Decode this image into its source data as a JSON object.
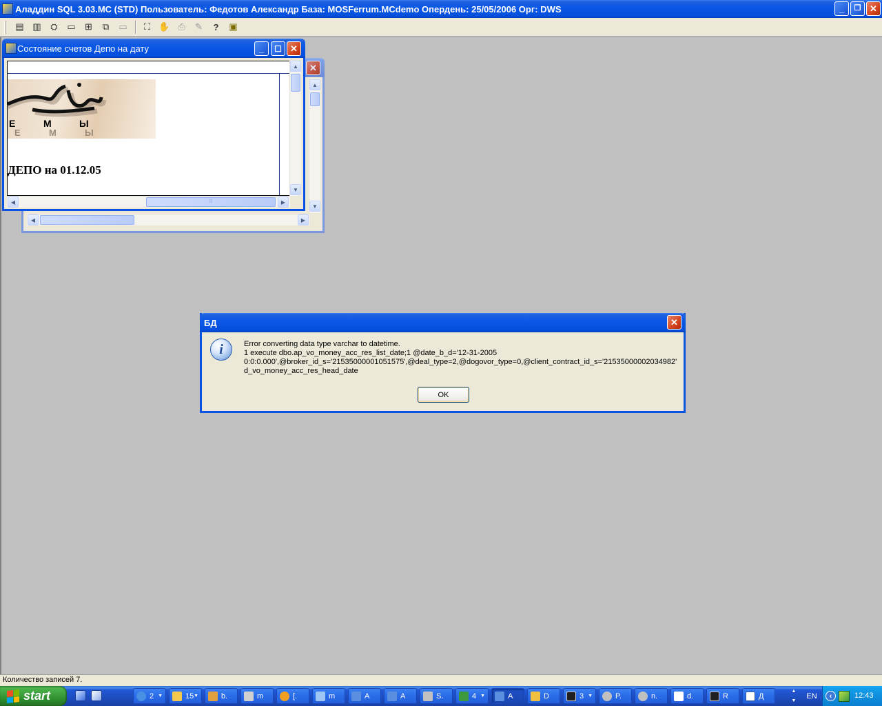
{
  "app": {
    "title": "Аладдин SQL 3.03.MC (STD)  Пользователь: Федотов Александр База: MOSFerrum.MCdemo Опердень: 25/05/2006 Орг: DWS",
    "caption_buttons": {
      "minimize": "_",
      "restore": "❐",
      "close": "✕"
    }
  },
  "toolbar": {
    "icons": [
      "list-icon",
      "database-icon",
      "tree-icon",
      "window-icon",
      "tile-icon",
      "cascade-icon",
      "window-disabled-icon",
      "find-icon",
      "stop-icon",
      "print-icon",
      "edit-disabled-icon",
      "help-icon",
      "exit-icon"
    ],
    "glyphs": [
      "▤",
      "▥",
      "⛭",
      "▭",
      "⊞",
      "⧉",
      "▭",
      "⛶",
      "✋",
      "⎙",
      "✎",
      "?",
      "▣"
    ]
  },
  "window_front": {
    "title": "Состояние счетов Депо на дату",
    "logo_letters": [
      "Е",
      "М",
      "Ы"
    ],
    "logo_shadow_letters": [
      "Е",
      "М",
      "Ы"
    ],
    "heading": "ДЕПО на 01.12.05",
    "caption_buttons": {
      "minimize": "_",
      "maximize": "☐",
      "close": "✕"
    }
  },
  "window_back": {
    "caption_buttons": {
      "close": "✕"
    }
  },
  "scroll_glyphs": {
    "up": "▲",
    "down": "▼",
    "left": "◀",
    "right": "▶",
    "grip": "⦙⦙⦙"
  },
  "dialog": {
    "title": "БД",
    "icon": "info-icon",
    "icon_glyph": "i",
    "lines": [
      "Error converting data type varchar to datetime.",
      "1 execute dbo.ap_vo_money_acc_res_list_date;1 @date_b_d='12-31-2005",
      "0:0:0.000',@broker_id_s='21535000001051575',@deal_type=2,@dogovor_type=0,@client_contract_id_s='21535000002034982'",
      "d_vo_money_acc_res_head_date"
    ],
    "ok_label": "OK",
    "close_glyph": "✕"
  },
  "statusbar": {
    "text": "Количество записей 7."
  },
  "taskbar": {
    "start_label": "start",
    "buttons": [
      {
        "label": "2",
        "group": true,
        "color": "#4a90e2"
      },
      {
        "label": "15",
        "group": true,
        "color": "#f2c94c"
      },
      {
        "label": "b.",
        "group": false,
        "color": "#e0a040"
      },
      {
        "label": "m",
        "group": false,
        "color": "#d0d0d0"
      },
      {
        "label": "[.",
        "group": false,
        "color": "#f0a020"
      },
      {
        "label": "m",
        "group": false,
        "color": "#9ec6f5"
      },
      {
        "label": "A",
        "group": false,
        "color": "#5a8fe0"
      },
      {
        "label": "A",
        "group": false,
        "color": "#5a8fe0"
      },
      {
        "label": "S.",
        "group": false,
        "color": "#c0c0c0"
      },
      {
        "label": "4",
        "group": true,
        "color": "#3c9a3c"
      },
      {
        "label": "A",
        "group": false,
        "color": "#5a8fe0"
      },
      {
        "label": "D",
        "group": false,
        "color": "#f0c040"
      },
      {
        "label": "3",
        "group": true,
        "color": "#202020"
      },
      {
        "label": "P.",
        "group": false,
        "color": "#c0c0c0"
      },
      {
        "label": "n.",
        "group": false,
        "color": "#c0c0c0"
      },
      {
        "label": "d.",
        "group": false,
        "color": "#ffffff"
      },
      {
        "label": "R",
        "group": false,
        "color": "#202020"
      },
      {
        "label": "Д",
        "group": false,
        "color": "#ffffff"
      }
    ],
    "group_arrow": "▼",
    "lang": "EN",
    "clock": "12:43",
    "tray_arrow": "‹",
    "scroll_up": "▲",
    "scroll_down": "▼"
  }
}
